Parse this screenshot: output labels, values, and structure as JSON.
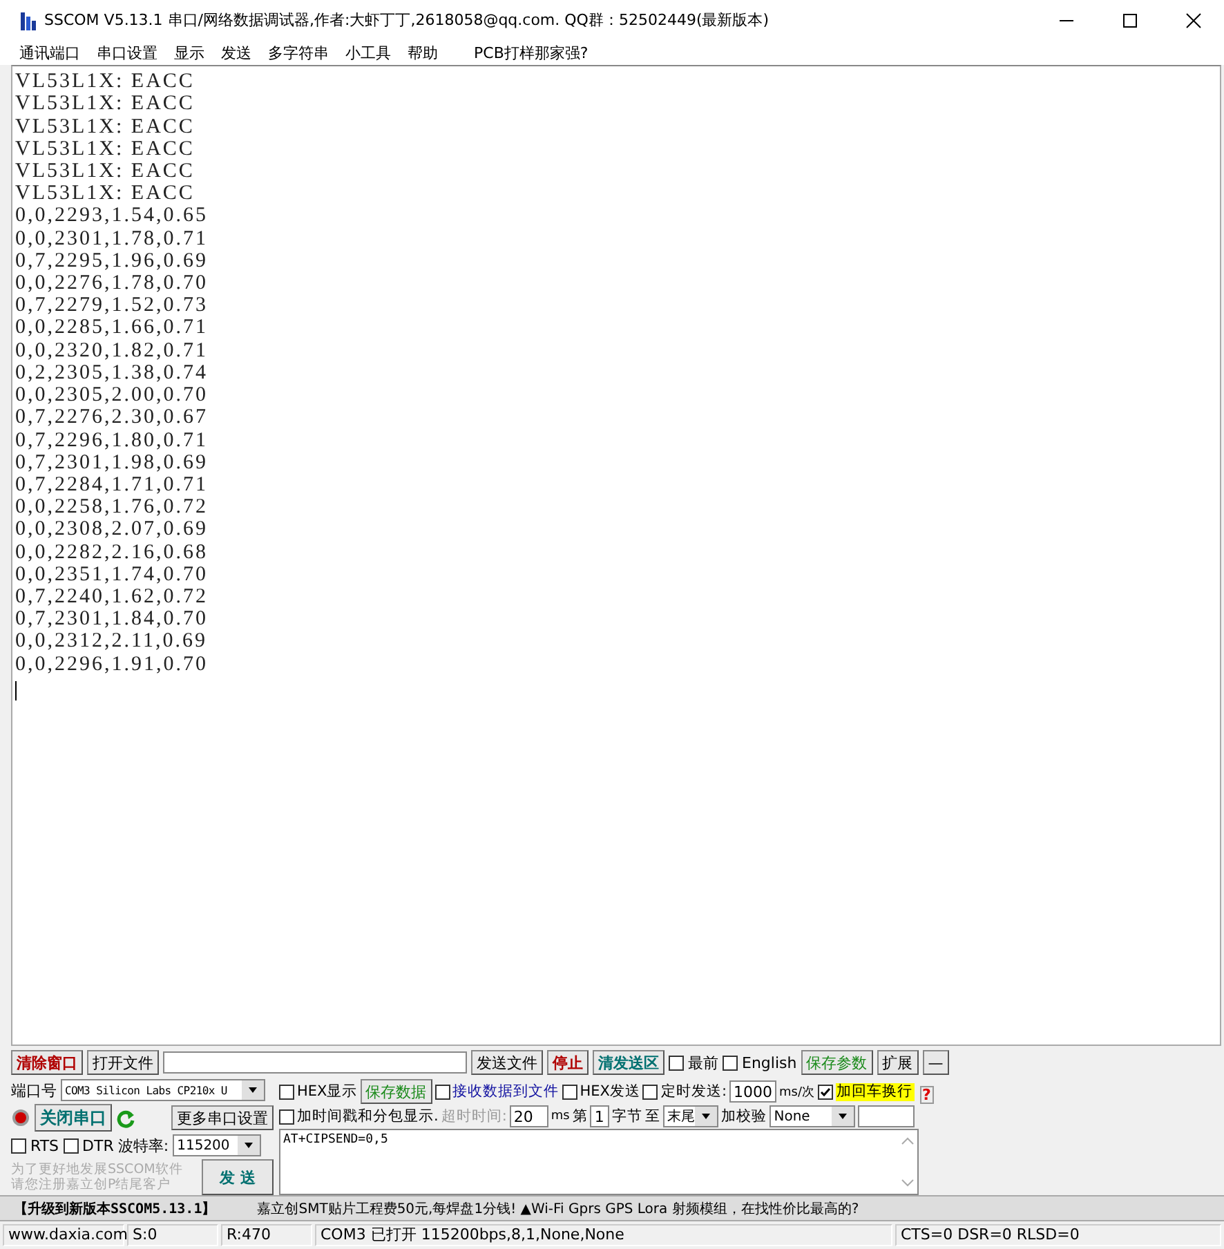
{
  "window": {
    "title": "SSCOM V5.13.1 串口/网络数据调试器,作者:大虾丁丁,2618058@qq.com. QQ群：52502449(最新版本)"
  },
  "menu": [
    "通讯端口",
    "串口设置",
    "显示",
    "发送",
    "多字符串",
    "小工具",
    "帮助",
    "PCB打样那家强?"
  ],
  "terminal": {
    "lines": [
      "VL53L1X: EACC",
      "VL53L1X: EACC",
      "VL53L1X: EACC",
      "VL53L1X: EACC",
      "VL53L1X: EACC",
      "VL53L1X: EACC",
      "0,0,2293,1.54,0.65",
      "0,0,2301,1.78,0.71",
      "0,7,2295,1.96,0.69",
      "0,0,2276,1.78,0.70",
      "0,7,2279,1.52,0.73",
      "0,0,2285,1.66,0.71",
      "0,0,2320,1.82,0.71",
      "0,2,2305,1.38,0.74",
      "0,0,2305,2.00,0.70",
      "0,7,2276,2.30,0.67",
      "0,7,2296,1.80,0.71",
      "0,7,2301,1.98,0.69",
      "0,7,2284,1.71,0.71",
      "0,0,2258,1.76,0.72",
      "0,0,2308,2.07,0.69",
      "0,0,2282,2.16,0.68",
      "0,0,2351,1.74,0.70",
      "0,7,2240,1.62,0.72",
      "0,7,2301,1.84,0.70",
      "0,0,2312,2.11,0.69",
      "0,0,2296,1.91,0.70"
    ]
  },
  "toolbar": {
    "clear_button": "清除窗口",
    "open_file_button": "打开文件",
    "send_file_button": "发送文件",
    "stop_button": "停止",
    "clear_send_button": "清发送区",
    "topmost": {
      "label": "最前",
      "checked": false
    },
    "english": {
      "label": "English",
      "checked": false
    },
    "save_params_button": "保存参数",
    "expand_button": "扩展",
    "collapse_button": "—"
  },
  "port": {
    "label": "端口号",
    "value": "COM3 Silicon Labs CP210x U",
    "close_port_button": "关闭串口",
    "more_settings_button": "更多串口设置",
    "rts": {
      "label": "RTS",
      "checked": false
    },
    "dtr": {
      "label": "DTR",
      "checked": false
    },
    "baud_label": "波特率:",
    "baud_value": "115200"
  },
  "promo": [
    "为了更好地发展SSCOM软件",
    "请您注册嘉立创P结尾客户"
  ],
  "send_button": "发 送",
  "options": {
    "hex_display": {
      "label": "HEX显示",
      "checked": false
    },
    "save_data_button": "保存数据",
    "receive_to_file": {
      "label": "接收数据到文件",
      "checked": false
    },
    "hex_send": {
      "label": "HEX发送",
      "checked": false
    },
    "timed_send": {
      "label": "定时发送:",
      "checked": false
    },
    "interval": "1000",
    "interval_unit": "ms/次",
    "add_crlf": {
      "label": "加回车换行",
      "checked": true
    },
    "help_mark": "?",
    "timestamp": {
      "label": "加时间戳和分包显示.",
      "checked": false
    },
    "timeout_label": "超时时间:",
    "timeout": "20",
    "timeout_unit": "ms",
    "from_label": "第",
    "from_value": "1",
    "byte_label": "字节",
    "to_label": "至",
    "to_value": "末尾",
    "checksum_label": "加校验",
    "checksum_value": "None"
  },
  "send_text": "AT+CIPSEND=0,5",
  "ad_bar": {
    "upgrade": "【升级到新版本SSCOM5.13.1】",
    "message": "嘉立创SMT贴片工程费50元,每焊盘1分钱! ▲Wi-Fi Gprs GPS Lora 射频模组，在找性价比最高的?"
  },
  "status_bar": [
    "www.daxia.com",
    "S:0",
    "R:470",
    "COM3 已打开  115200bps,8,1,None,None",
    "CTS=0 DSR=0 RLSD=0"
  ]
}
